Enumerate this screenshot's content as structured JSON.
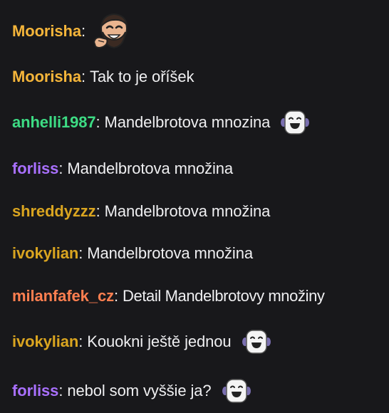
{
  "colors": {
    "background": "#18181b",
    "text": "#efeff1",
    "moorisha": "#f5b53a",
    "anhelli1987": "#3ddc84",
    "forliss": "#a970ff",
    "shreddyzzz": "#daa520",
    "ivokylian": "#daa520",
    "milanfafek_cz": "#ff7f50"
  },
  "messages": [
    {
      "user": "Moorisha",
      "sep": ":",
      "text": "",
      "emote": "bearded-man-laughing-emote"
    },
    {
      "user": "Moorisha",
      "sep": ":",
      "text": "Tak to je oříšek",
      "emote": ""
    },
    {
      "user": "anhelli1987",
      "sep": ":",
      "text": "Mandelbrotova mnozina",
      "emote": "white-grinning-face-emote"
    },
    {
      "user": "forliss",
      "sep": ":",
      "text": "Mandelbrotova množina",
      "emote": ""
    },
    {
      "user": "shreddyzzz",
      "sep": ":",
      "text": "Mandelbrotova množina",
      "emote": ""
    },
    {
      "user": "ivokylian",
      "sep": ":",
      "text": "Mandelbrotova množina",
      "emote": ""
    },
    {
      "user": "milanfafek_cz",
      "sep": ":",
      "text": "Detail Mandelbrotovy množiny",
      "emote": ""
    },
    {
      "user": "ivokylian",
      "sep": ":",
      "text": "Kouokni ještě jednou",
      "emote": "white-grinning-face-emote"
    },
    {
      "user": "forliss",
      "sep": ":",
      "text": "nebol som vyššie ja?",
      "emote": "white-grinning-face-emote"
    }
  ]
}
